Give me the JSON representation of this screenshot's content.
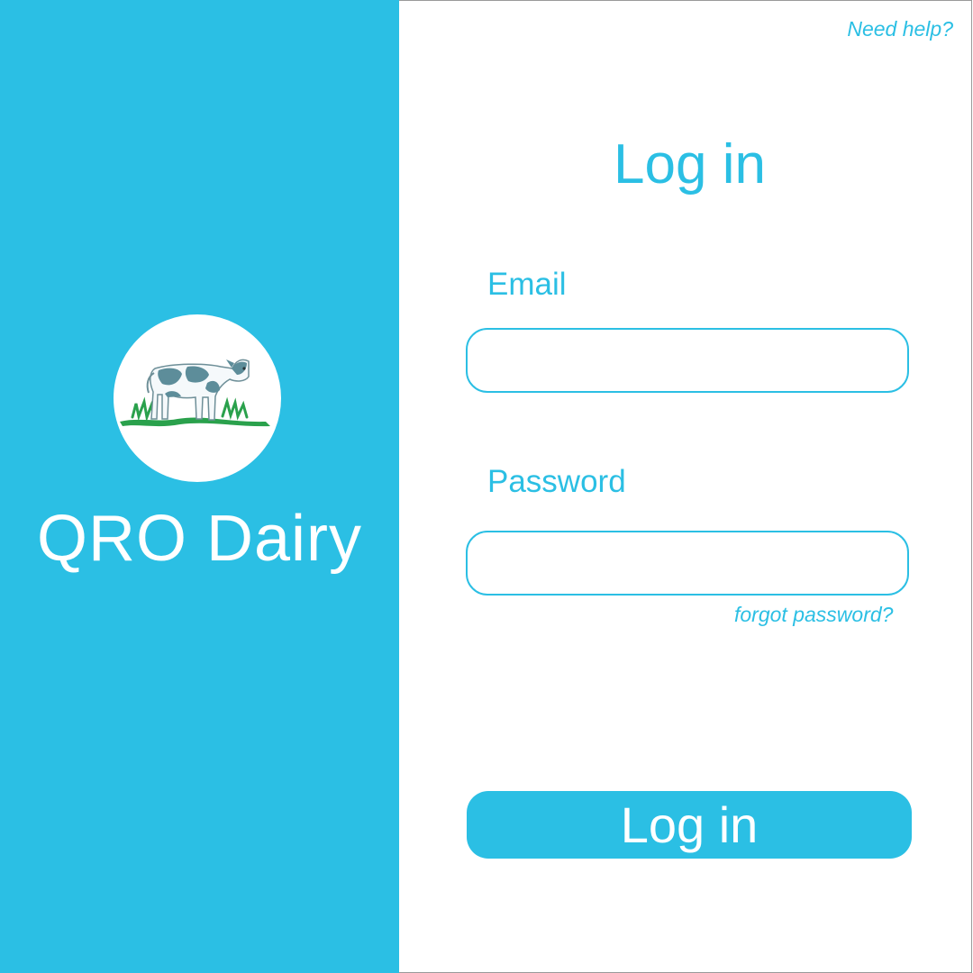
{
  "brand": {
    "name": "QRO Dairy",
    "logo_icon": "cow-icon",
    "panel_color": "#2bbfe4"
  },
  "header": {
    "help_link": "Need help?"
  },
  "login": {
    "title": "Log in",
    "email_label": "Email",
    "email_value": "",
    "password_label": "Password",
    "password_value": "",
    "forgot_password_link": "forgot password?",
    "submit_label": "Log in",
    "accent_color": "#2bbfe4"
  }
}
